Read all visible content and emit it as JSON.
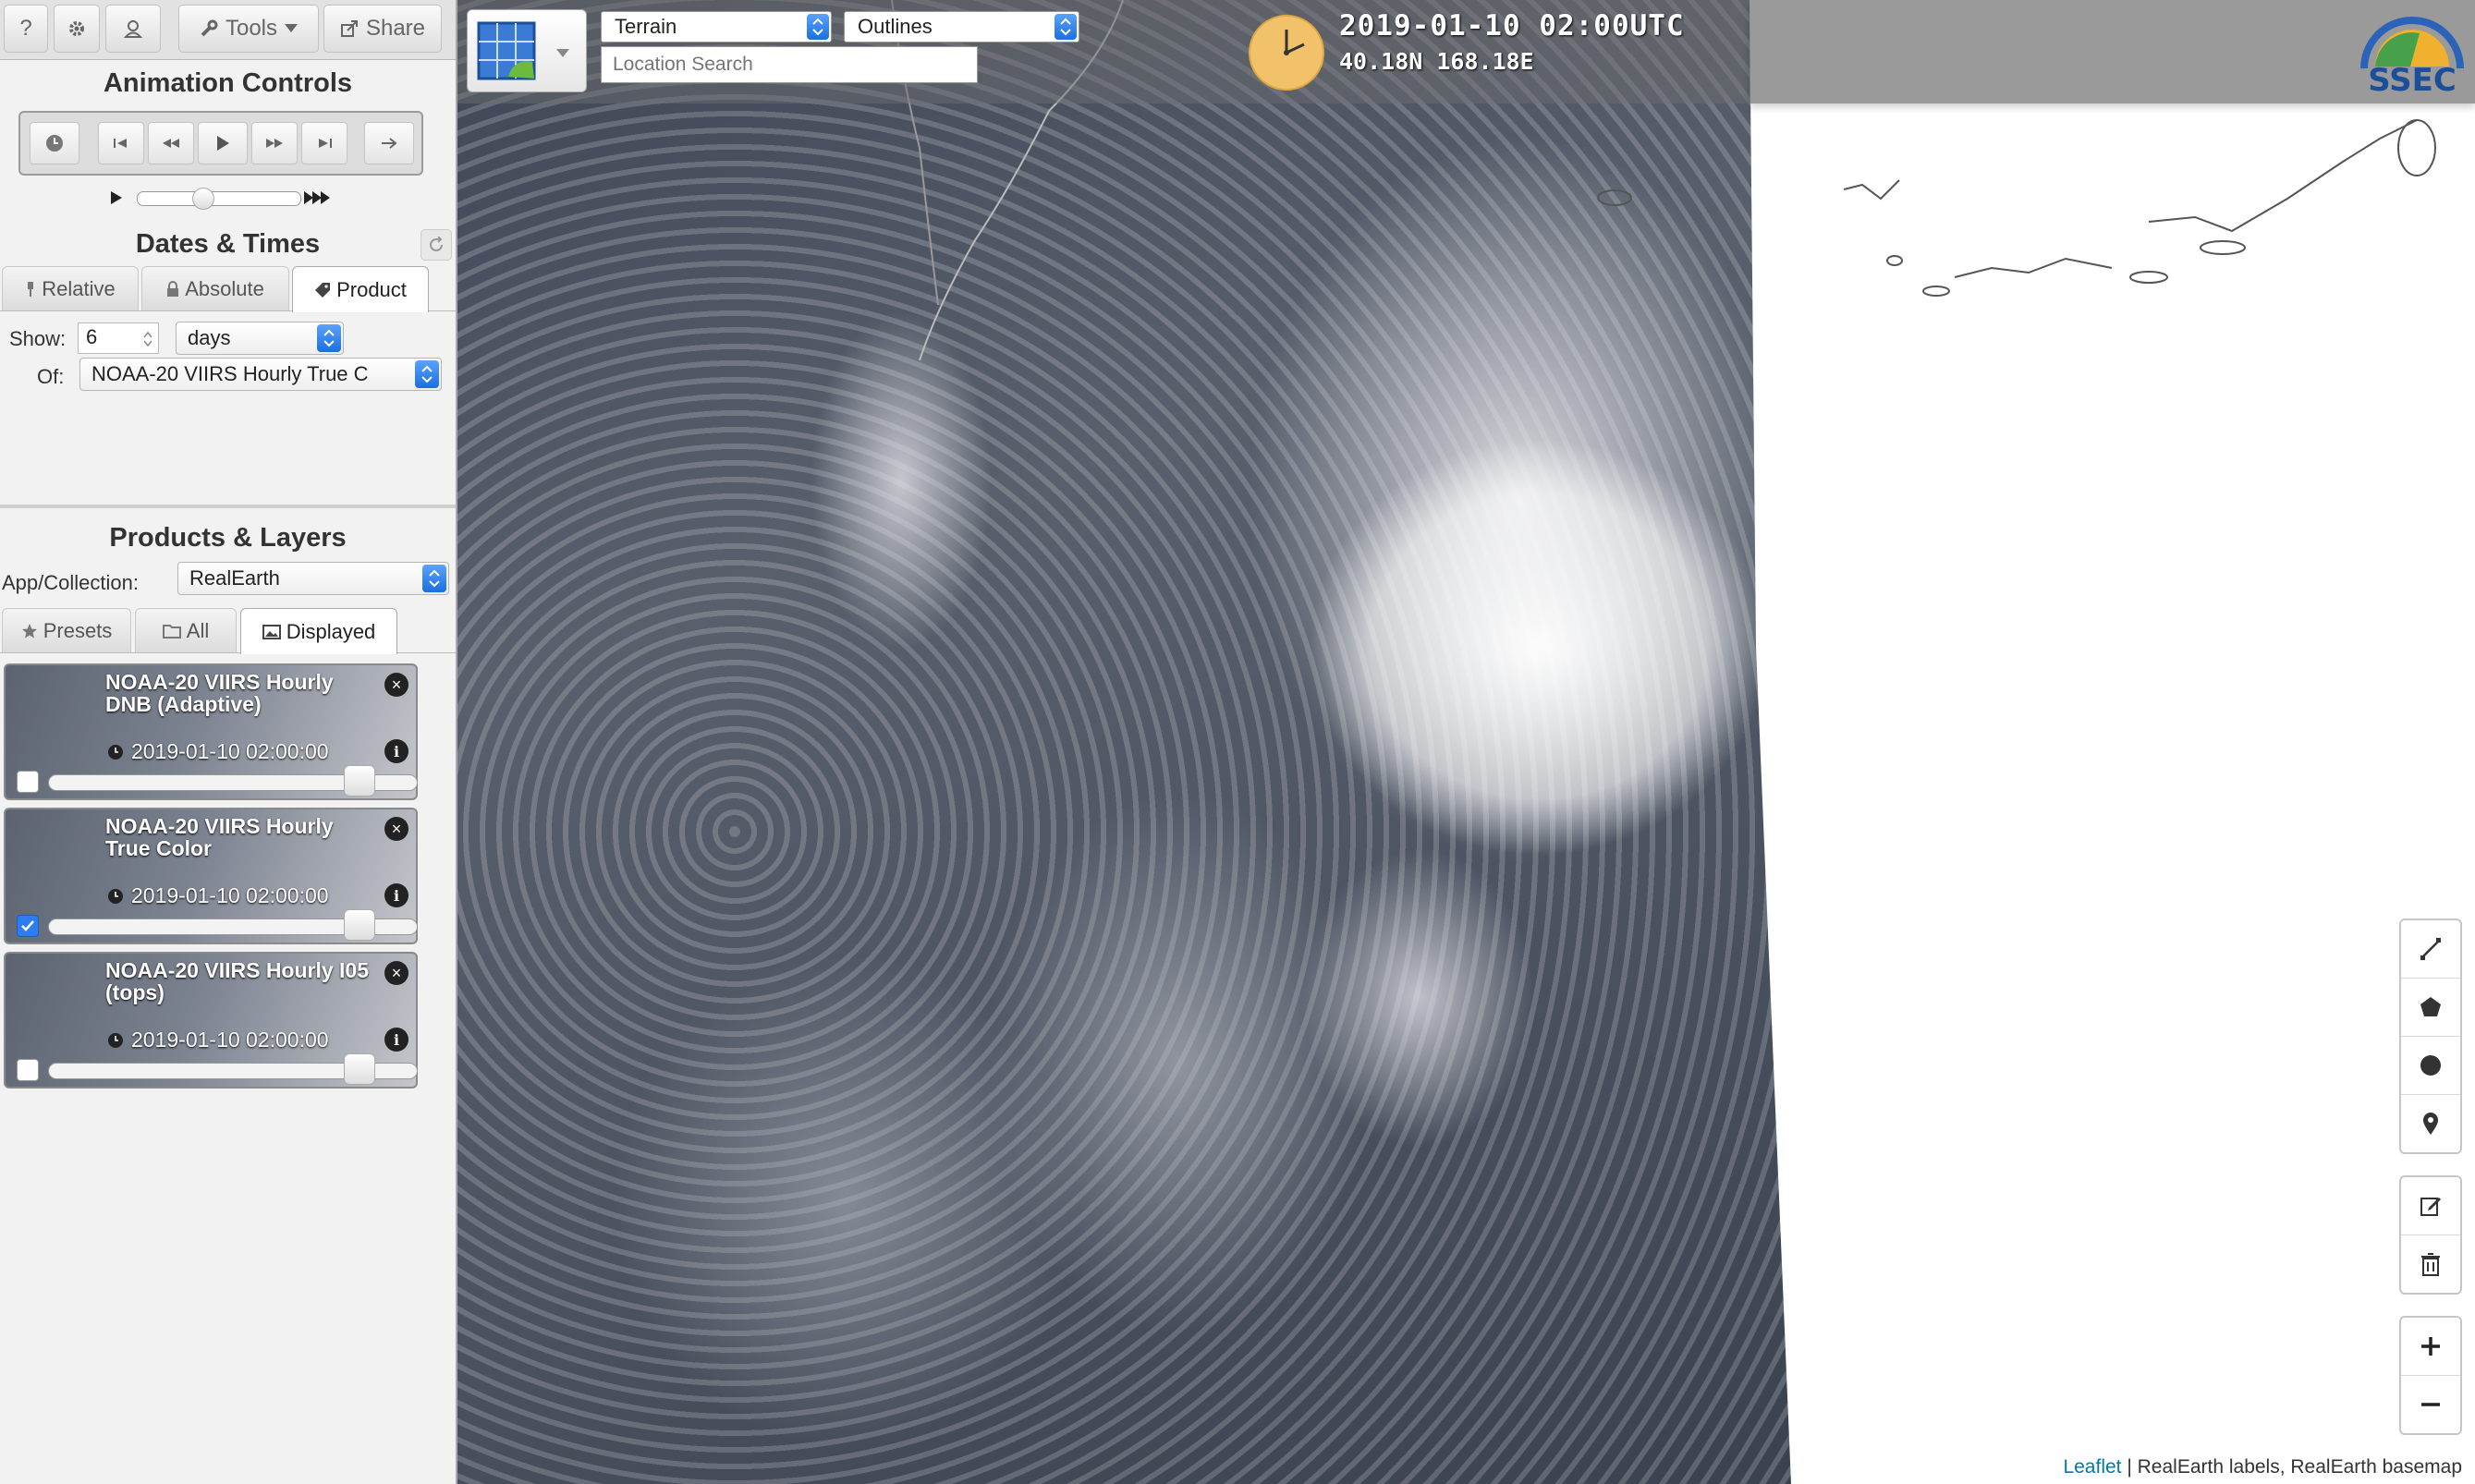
{
  "toolbar": {
    "help_label": "?",
    "tools_label": "Tools",
    "share_label": "Share"
  },
  "animation": {
    "title": "Animation Controls"
  },
  "dates": {
    "title": "Dates & Times",
    "tabs": [
      "Relative",
      "Absolute",
      "Product"
    ],
    "active_tab": "Product",
    "show_label": "Show:",
    "show_value": "6",
    "unit_value": "days",
    "of_label": "Of:",
    "of_value": "NOAA-20 VIIRS Hourly True C"
  },
  "products": {
    "title": "Products & Layers",
    "collection_label": "App/Collection:",
    "collection_value": "RealEarth",
    "tabs": [
      "Presets",
      "All",
      "Displayed"
    ],
    "active_tab": "Displayed",
    "layers": [
      {
        "title": "NOAA-20 VIIRS Hourly DNB (Adaptive)",
        "time": "2019-01-10 02:00:00",
        "checked": false,
        "opacity": 1.0
      },
      {
        "title": "NOAA-20 VIIRS Hourly True Color",
        "time": "2019-01-10 02:00:00",
        "checked": true,
        "opacity": 1.0
      },
      {
        "title": "NOAA-20 VIIRS Hourly I05 (tops)",
        "time": "2019-01-10 02:00:00",
        "checked": false,
        "opacity": 1.0
      }
    ]
  },
  "map": {
    "basemap_value": "Terrain",
    "overlay_value": "Outlines",
    "search_placeholder": "Location Search",
    "timestamp": "2019-01-10 02:00UTC",
    "coords": "40.18N 168.18E",
    "logo_text": "SSEC",
    "attribution_link": "Leaflet",
    "attribution_text": " | RealEarth labels, RealEarth basemap"
  },
  "colors": {
    "accent_blue": "#2d7df0",
    "clock_fill": "#f2c26a"
  }
}
